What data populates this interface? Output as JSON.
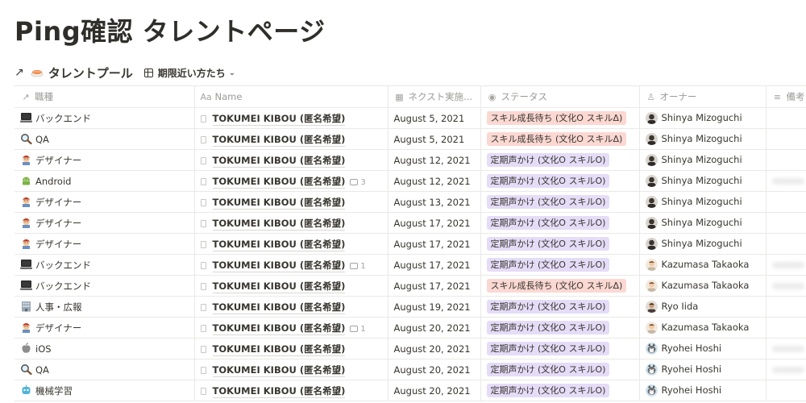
{
  "page": {
    "title": "Ping確認 タレントページ"
  },
  "database": {
    "title": "タレントプール",
    "view_label": "期限近い方たち"
  },
  "columns": [
    {
      "label": "職種",
      "icon": "arrow-icon"
    },
    {
      "label": "Name",
      "icon": "text-icon"
    },
    {
      "label": "ネクスト実施...",
      "icon": "calendar-icon"
    },
    {
      "label": "ステータス",
      "icon": "status-icon"
    },
    {
      "label": "オーナー",
      "icon": "person-icon"
    },
    {
      "label": "備考",
      "icon": "text-lines-icon"
    }
  ],
  "colors": {
    "tag_red": "#fcd8d3",
    "tag_purple": "#e5dcf7"
  },
  "rows": [
    {
      "job": "バックエンド",
      "job_icon": "laptop-icon",
      "name": "TOKUMEI KIBOU (匿名希望)",
      "comments": "",
      "date": "August 5, 2021",
      "status": "スキル成長待ち (文化O スキルΔ)",
      "status_color": "red",
      "owner": "Shinya Mizoguchi",
      "owner_avatar": "dark"
    },
    {
      "job": "QA",
      "job_icon": "magnifier-icon",
      "name": "TOKUMEI KIBOU (匿名希望)",
      "comments": "",
      "date": "August 5, 2021",
      "status": "スキル成長待ち (文化O スキルΔ)",
      "status_color": "red",
      "owner": "Shinya Mizoguchi",
      "owner_avatar": "dark"
    },
    {
      "job": "デザイナー",
      "job_icon": "artist-icon",
      "name": "TOKUMEI KIBOU (匿名希望)",
      "comments": "",
      "date": "August 12, 2021",
      "status": "定期声かけ (文化O スキルO)",
      "status_color": "purple",
      "owner": "Shinya Mizoguchi",
      "owner_avatar": "dark"
    },
    {
      "job": "Android",
      "job_icon": "android-icon",
      "name": "TOKUMEI KIBOU (匿名希望)",
      "comments": "3",
      "date": "August 12, 2021",
      "status": "定期声かけ (文化O スキルO)",
      "status_color": "purple",
      "owner": "Shinya Mizoguchi",
      "owner_avatar": "dark"
    },
    {
      "job": "デザイナー",
      "job_icon": "artist-icon",
      "name": "TOKUMEI KIBOU (匿名希望)",
      "comments": "",
      "date": "August 13, 2021",
      "status": "定期声かけ (文化O スキルO)",
      "status_color": "purple",
      "owner": "Shinya Mizoguchi",
      "owner_avatar": "dark"
    },
    {
      "job": "デザイナー",
      "job_icon": "artist-icon",
      "name": "TOKUMEI KIBOU (匿名希望)",
      "comments": "",
      "date": "August 17, 2021",
      "status": "定期声かけ (文化O スキルO)",
      "status_color": "purple",
      "owner": "Shinya Mizoguchi",
      "owner_avatar": "dark"
    },
    {
      "job": "デザイナー",
      "job_icon": "artist-icon",
      "name": "TOKUMEI KIBOU (匿名希望)",
      "comments": "",
      "date": "August 17, 2021",
      "status": "定期声かけ (文化O スキルO)",
      "status_color": "purple",
      "owner": "Shinya Mizoguchi",
      "owner_avatar": "dark"
    },
    {
      "job": "バックエンド",
      "job_icon": "laptop-icon",
      "name": "TOKUMEI KIBOU (匿名希望)",
      "comments": "1",
      "date": "August 17, 2021",
      "status": "定期声かけ (文化O スキルO)",
      "status_color": "purple",
      "owner": "Kazumasa Takaoka",
      "owner_avatar": "light"
    },
    {
      "job": "バックエンド",
      "job_icon": "laptop-icon",
      "name": "TOKUMEI KIBOU (匿名希望)",
      "comments": "",
      "date": "August 17, 2021",
      "status": "スキル成長待ち (文化O スキルΔ)",
      "status_color": "red",
      "owner": "Kazumasa Takaoka",
      "owner_avatar": "light"
    },
    {
      "job": "人事・広報",
      "job_icon": "office-icon",
      "name": "TOKUMEI KIBOU (匿名希望)",
      "comments": "",
      "date": "August 19, 2021",
      "status": "定期声かけ (文化O スキルO)",
      "status_color": "purple",
      "owner": "Ryo Iida",
      "owner_avatar": "medium"
    },
    {
      "job": "デザイナー",
      "job_icon": "artist-icon",
      "name": "TOKUMEI KIBOU (匿名希望)",
      "comments": "1",
      "date": "August 20, 2021",
      "status": "定期声かけ (文化O スキルO)",
      "status_color": "purple",
      "owner": "Kazumasa Takaoka",
      "owner_avatar": "light"
    },
    {
      "job": "iOS",
      "job_icon": "apple-icon",
      "name": "TOKUMEI KIBOU (匿名希望)",
      "comments": "",
      "date": "August 20, 2021",
      "status": "定期声かけ (文化O スキルO)",
      "status_color": "purple",
      "owner": "Ryohei Hoshi",
      "owner_avatar": "cat"
    },
    {
      "job": "QA",
      "job_icon": "magnifier-icon",
      "name": "TOKUMEI KIBOU (匿名希望)",
      "comments": "",
      "date": "August 20, 2021",
      "status": "定期声かけ (文化O スキルO)",
      "status_color": "purple",
      "owner": "Ryohei Hoshi",
      "owner_avatar": "cat"
    },
    {
      "job": "機械学習",
      "job_icon": "robot-icon",
      "name": "TOKUMEI KIBOU (匿名希望)",
      "comments": "",
      "date": "August 20, 2021",
      "status": "定期声かけ (文化O スキルO)",
      "status_color": "purple",
      "owner": "Ryohei Hoshi",
      "owner_avatar": "cat"
    }
  ]
}
